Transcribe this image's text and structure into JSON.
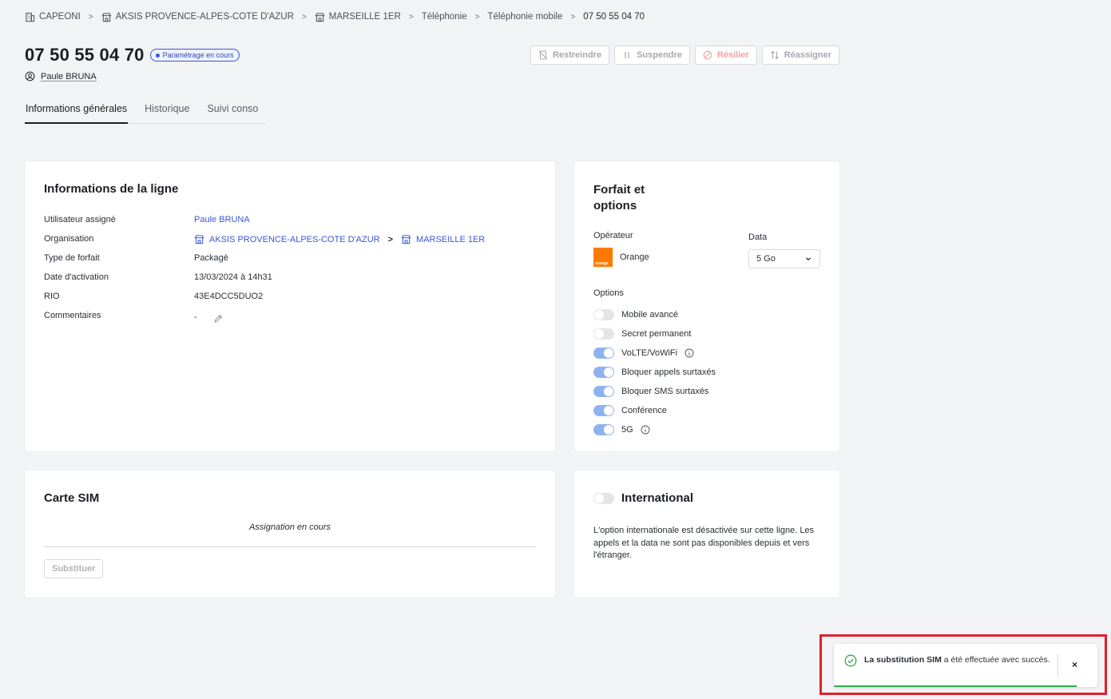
{
  "breadcrumb": {
    "items": [
      {
        "label": "CAPEONI",
        "icon": "building-icon"
      },
      {
        "label": "AKSIS PROVENCE-ALPES-COTE D'AZUR",
        "icon": "store-icon"
      },
      {
        "label": "MARSEILLE 1ER",
        "icon": "store-icon"
      },
      {
        "label": "Téléphonie"
      },
      {
        "label": "Téléphonie mobile"
      },
      {
        "label": "07 50 55 04 70"
      }
    ]
  },
  "header": {
    "line_number": "07 50 55 04 70",
    "status": "Paramétrage en cours",
    "owner": "Paule BRUNA"
  },
  "actions": {
    "restrict": "Restreindre",
    "suspend": "Suspendre",
    "terminate": "Résilier",
    "reassign": "Réassigner"
  },
  "tabs": [
    {
      "label": "Informations générales",
      "active": true
    },
    {
      "label": "Historique",
      "active": false
    },
    {
      "label": "Suivi conso",
      "active": false
    }
  ],
  "line_info": {
    "title": "Informations de la ligne",
    "rows": {
      "user": {
        "label": "Utilisateur assigné",
        "value": "Paule BRUNA"
      },
      "org": {
        "label": "Organisation",
        "value_1": "AKSIS PROVENCE-ALPES-COTE D'AZUR",
        "value_2": "MARSEILLE 1ER"
      },
      "plan_type": {
        "label": "Type de forfait",
        "value": "Packagé"
      },
      "activation": {
        "label": "Date d'activation",
        "value": "13/03/2024 à 14h31"
      },
      "rio": {
        "label": "RIO",
        "value": "43E4DCC5DUO2"
      },
      "comments": {
        "label": "Commentaires",
        "value": "-"
      }
    }
  },
  "plan": {
    "title_line1": "Forfait et",
    "title_line2": "options",
    "operator_label": "Opérateur",
    "operator_name": "Orange",
    "operator_logo_text": "orange",
    "data_label": "Data",
    "data_value": "5 Go",
    "options_label": "Options",
    "options": [
      {
        "label": "Mobile avancé",
        "on": false,
        "info": false
      },
      {
        "label": "Secret permanent",
        "on": false,
        "info": false
      },
      {
        "label": "VoLTE/VoWiFi",
        "on": true,
        "info": true
      },
      {
        "label": "Bloquer appels surtaxés",
        "on": true,
        "info": false
      },
      {
        "label": "Bloquer SMS surtaxés",
        "on": true,
        "info": false
      },
      {
        "label": "Conférence",
        "on": true,
        "info": false
      },
      {
        "label": "5G",
        "on": true,
        "info": true
      }
    ]
  },
  "sim": {
    "title": "Carte SIM",
    "status": "Assignation en cours",
    "button": "Substituer"
  },
  "international": {
    "title": "International",
    "enabled": false,
    "description": "L'option internationale est désactivée sur cette ligne. Les appels et la data ne sont pas disponibles depuis et vers l'étranger."
  },
  "toast": {
    "bold": "La substitution SIM",
    "rest": " a été effectuée avec succès.",
    "close": "×",
    "progress": 0.92
  },
  "colors": {
    "accent": "#3b57d6",
    "toggle_on": "#8fb2ef",
    "success": "#2faa4c",
    "orange": "#ff7900",
    "highlight": "#e0202c"
  }
}
